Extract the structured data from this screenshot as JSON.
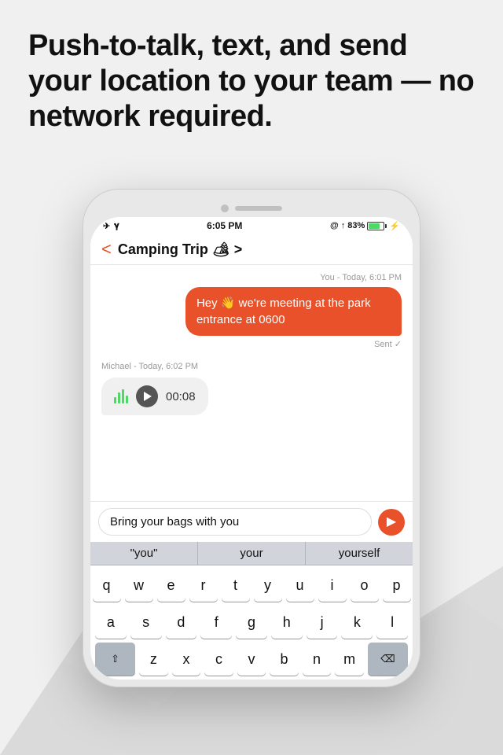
{
  "headline": "Push-to-talk, text, and send your location to your team — no network required.",
  "status": {
    "time": "6:05 PM",
    "battery_percent": "83%",
    "signal": "✈ ᯤ"
  },
  "chat": {
    "title": "Camping Trip 🏕 >",
    "back_label": "<",
    "message_sent_timestamp": "You - Today, 6:01 PM",
    "message_sent_text": "Hey 👋 we're meeting at the park entrance at 0600",
    "sent_status": "Sent ✓",
    "message_received_timestamp": "Michael - Today, 6:02 PM",
    "audio_duration": "00:08",
    "input_placeholder": "Bring your bags with you"
  },
  "autocomplete": {
    "items": [
      "\"you\"",
      "your",
      "yourself"
    ]
  },
  "keyboard": {
    "row1": [
      "q",
      "w",
      "e",
      "r",
      "t",
      "y",
      "u",
      "i",
      "o",
      "p"
    ],
    "row2": [
      "a",
      "s",
      "d",
      "f",
      "g",
      "h",
      "j",
      "k",
      "l"
    ],
    "row3": [
      "z",
      "x",
      "c",
      "v",
      "b",
      "n",
      "m"
    ]
  }
}
